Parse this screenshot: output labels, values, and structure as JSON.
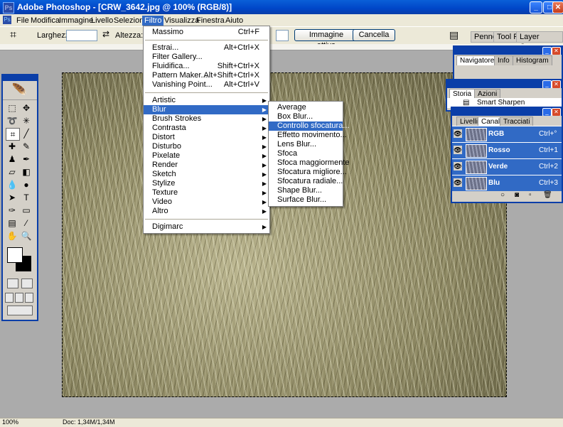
{
  "window": {
    "title": "Adobe Photoshop - [CRW_3642.jpg @ 100% (RGB/8)]"
  },
  "menubar": [
    "File",
    "Modifica",
    "Immagine",
    "Livello",
    "Selezione",
    "Filtro",
    "Visualizza",
    "Finestra",
    "Aiuto"
  ],
  "optbar": {
    "width_label": "Larghezza:",
    "height_label": "Altezza:",
    "front_image_button": "Immagine attiva",
    "clear_button": "Cancella",
    "palette_tabs": [
      "Pennell",
      "Tool Pr",
      "Layer Comps"
    ]
  },
  "filter_menu": {
    "items": [
      {
        "label": "Massimo",
        "shortcut": "Ctrl+F"
      },
      {
        "label": "Estrai...",
        "shortcut": "Alt+Ctrl+X"
      },
      {
        "label": "Filter Gallery...",
        "shortcut": ""
      },
      {
        "label": "Fluidifica...",
        "shortcut": "Shift+Ctrl+X"
      },
      {
        "label": "Pattern Maker...",
        "shortcut": "Alt+Shift+Ctrl+X"
      },
      {
        "label": "Vanishing Point...",
        "shortcut": "Alt+Ctrl+V"
      },
      {
        "label": "Artistic",
        "shortcut": ""
      },
      {
        "label": "Blur",
        "shortcut": ""
      },
      {
        "label": "Brush Strokes",
        "shortcut": ""
      },
      {
        "label": "Contrasta",
        "shortcut": ""
      },
      {
        "label": "Distort",
        "shortcut": ""
      },
      {
        "label": "Disturbo",
        "shortcut": ""
      },
      {
        "label": "Pixelate",
        "shortcut": ""
      },
      {
        "label": "Render",
        "shortcut": ""
      },
      {
        "label": "Sketch",
        "shortcut": ""
      },
      {
        "label": "Stylize",
        "shortcut": ""
      },
      {
        "label": "Texture",
        "shortcut": ""
      },
      {
        "label": "Video",
        "shortcut": ""
      },
      {
        "label": "Altro",
        "shortcut": ""
      },
      {
        "label": "Digimarc",
        "shortcut": ""
      }
    ]
  },
  "blur_menu": {
    "items": [
      "Average",
      "Box Blur...",
      "Controllo sfocatura...",
      "Effetto movimento...",
      "Lens Blur...",
      "Sfoca",
      "Sfoca maggiormente",
      "Sfocatura migliore...",
      "Sfocatura radiale...",
      "Shape Blur...",
      "Surface Blur..."
    ]
  },
  "navigator_palette": {
    "tabs": [
      "Navigatore",
      "Info",
      "Histogram"
    ]
  },
  "history_palette": {
    "tabs": [
      "Storia",
      "Azioni"
    ],
    "state": "Smart Sharpen"
  },
  "channels_palette": {
    "tabs": [
      "Livelli",
      "Canali",
      "Tracciati"
    ],
    "rows": [
      {
        "name": "RGB",
        "shortcut": "Ctrl+°"
      },
      {
        "name": "Rosso",
        "shortcut": "Ctrl+1"
      },
      {
        "name": "Verde",
        "shortcut": "Ctrl+2"
      },
      {
        "name": "Blu",
        "shortcut": "Ctrl+3"
      }
    ]
  },
  "statusbar": {
    "zoom": "100%",
    "doc": "Doc: 1,34M/1,34M"
  },
  "colors": {
    "highlight": "#316ac5",
    "titlebar": "#0046c8",
    "chrome": "#ece9d8"
  }
}
